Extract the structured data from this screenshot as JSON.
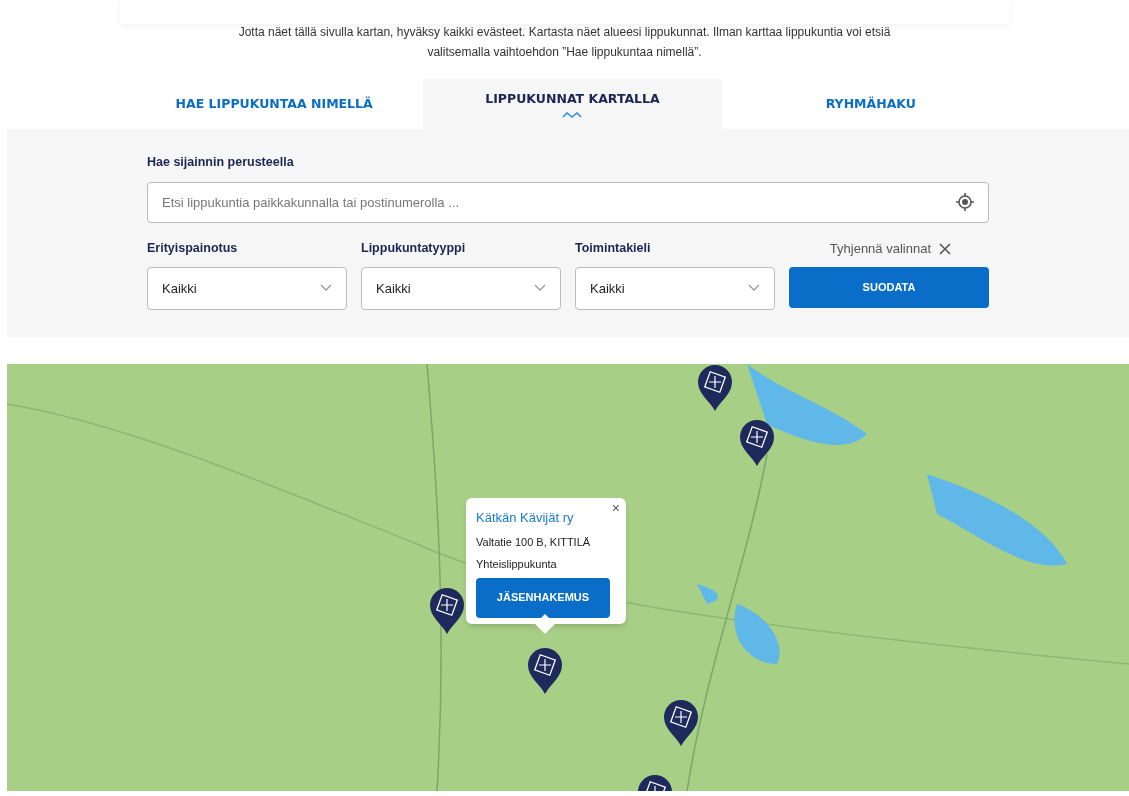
{
  "intro": "Jotta näet tällä sivulla kartan, hyväksy kaikki evästeet. Kartasta näet alueesi lippukunnat. Ilman karttaa lippukuntia voi etsiä valitsemalla vaihtoehdon ”Hae lippukuntaa nimellä”.",
  "tabs": [
    {
      "label": "HAE LIPPUKUNTAA NIMELLÄ",
      "selected": false
    },
    {
      "label": "LIPPUKUNNAT KARTALLA",
      "selected": true
    },
    {
      "label": "RYHMÄHAKU",
      "selected": false
    }
  ],
  "location": {
    "label": "Hae sijainnin perusteella",
    "placeholder": "Etsi lippukuntia paikkakunnalla tai postinumerolla ..."
  },
  "filters": [
    {
      "label": "Erityispainotus",
      "value": "Kaikki"
    },
    {
      "label": "Lippukuntatyyppi",
      "value": "Kaikki"
    },
    {
      "label": "Toimintakieli",
      "value": "Kaikki"
    }
  ],
  "clear": "Tyhjennä valinnat",
  "submit": "SUODATA",
  "popup": {
    "name": "Kätkän Kävijät ry",
    "address": "Valtatie 100 B, KITTILÄ",
    "type": "Yhteislippukunta",
    "button": "JÄSENHAKEMUS",
    "close": "×"
  }
}
